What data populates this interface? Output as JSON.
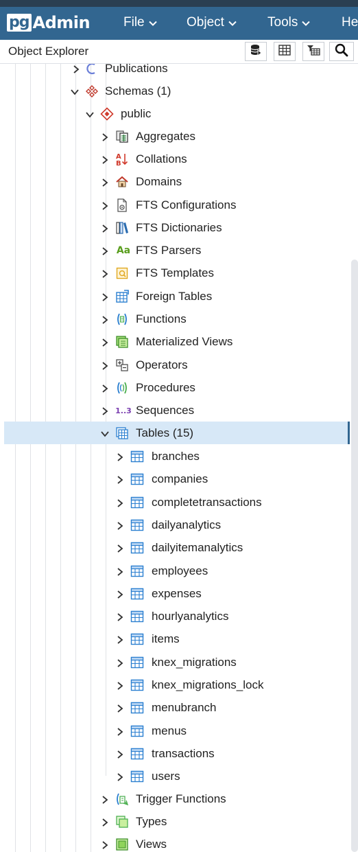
{
  "app": {
    "logo_pg": "pg",
    "logo_admin": "Admin",
    "menus": [
      {
        "label": "File"
      },
      {
        "label": "Object"
      },
      {
        "label": "Tools"
      },
      {
        "label": "He"
      }
    ]
  },
  "explorer": {
    "title": "Object Explorer",
    "toolbar_icons": [
      "query-tool-icon",
      "view-data-icon",
      "filtered-rows-icon",
      "search-objects-icon"
    ]
  },
  "tree": {
    "publications": {
      "label": "Publications"
    },
    "schemas": {
      "label": "Schemas (1)"
    },
    "public": {
      "label": "public"
    },
    "aggregates": {
      "label": "Aggregates"
    },
    "collations": {
      "label": "Collations"
    },
    "domains": {
      "label": "Domains"
    },
    "fts_configurations": {
      "label": "FTS Configurations"
    },
    "fts_dictionaries": {
      "label": "FTS Dictionaries"
    },
    "fts_parsers": {
      "label": "FTS Parsers",
      "icon_text": "Aa"
    },
    "fts_templates": {
      "label": "FTS Templates"
    },
    "foreign_tables": {
      "label": "Foreign Tables"
    },
    "functions": {
      "label": "Functions"
    },
    "materialized_views": {
      "label": "Materialized Views"
    },
    "operators": {
      "label": "Operators"
    },
    "procedures": {
      "label": "Procedures"
    },
    "sequences": {
      "label": "Sequences",
      "icon_text": "1..3"
    },
    "tables": {
      "label": "Tables (15)"
    },
    "table_items": [
      {
        "label": "branches"
      },
      {
        "label": "companies"
      },
      {
        "label": "completetransactions"
      },
      {
        "label": "dailyanalytics"
      },
      {
        "label": "dailyitemanalytics"
      },
      {
        "label": "employees"
      },
      {
        "label": "expenses"
      },
      {
        "label": "hourlyanalytics"
      },
      {
        "label": "items"
      },
      {
        "label": "knex_migrations"
      },
      {
        "label": "knex_migrations_lock"
      },
      {
        "label": "menubranch"
      },
      {
        "label": "menus"
      },
      {
        "label": "transactions"
      },
      {
        "label": "users"
      }
    ],
    "trigger_functions": {
      "label": "Trigger Functions"
    },
    "types": {
      "label": "Types"
    },
    "views": {
      "label": "Views"
    }
  },
  "colors": {
    "header_bar": "#326690",
    "selection": "#d7e8f7",
    "table_icon": "#2b7fd0"
  }
}
